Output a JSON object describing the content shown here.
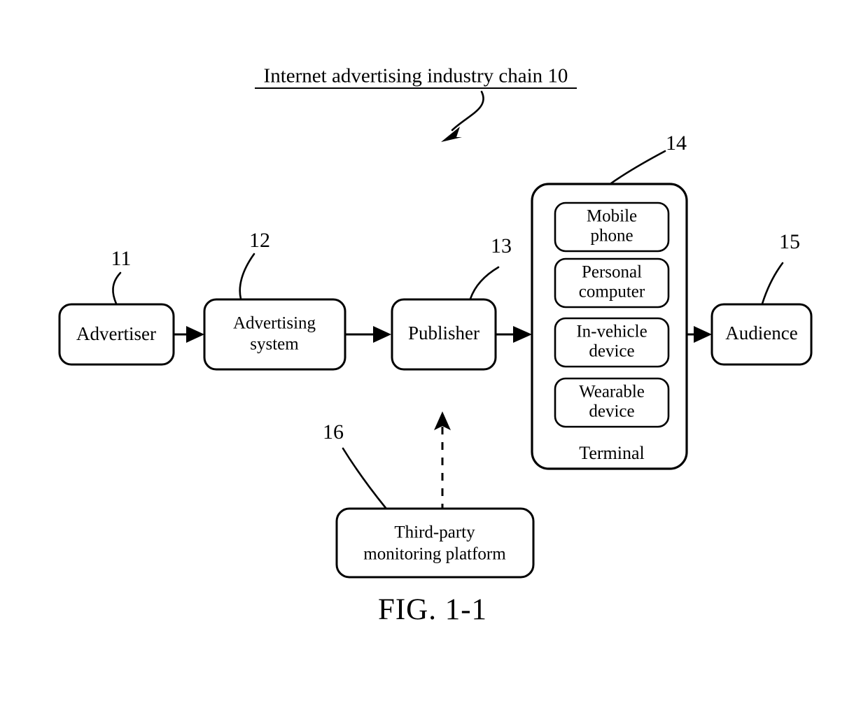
{
  "figure": {
    "title": "Internet advertising industry chain 10",
    "caption": "FIG. 1-1"
  },
  "nodes": {
    "advertiser": {
      "label": "Advertiser",
      "ref": "11"
    },
    "advertising_system": {
      "line1": "Advertising",
      "line2": "system",
      "ref": "12"
    },
    "publisher": {
      "label": "Publisher",
      "ref": "13"
    },
    "terminal": {
      "label": "Terminal",
      "ref": "14"
    },
    "audience": {
      "label": "Audience",
      "ref": "15"
    },
    "third_party": {
      "line1": "Third-party",
      "line2": "monitoring platform",
      "ref": "16"
    }
  },
  "terminal_devices": [
    {
      "line1": "Mobile",
      "line2": "phone"
    },
    {
      "line1": "Personal",
      "line2": "computer"
    },
    {
      "line1": "In-vehicle",
      "line2": "device"
    },
    {
      "line1": "Wearable",
      "line2": "device"
    }
  ],
  "colors": {
    "ink": "#000000",
    "paper": "#ffffff"
  }
}
